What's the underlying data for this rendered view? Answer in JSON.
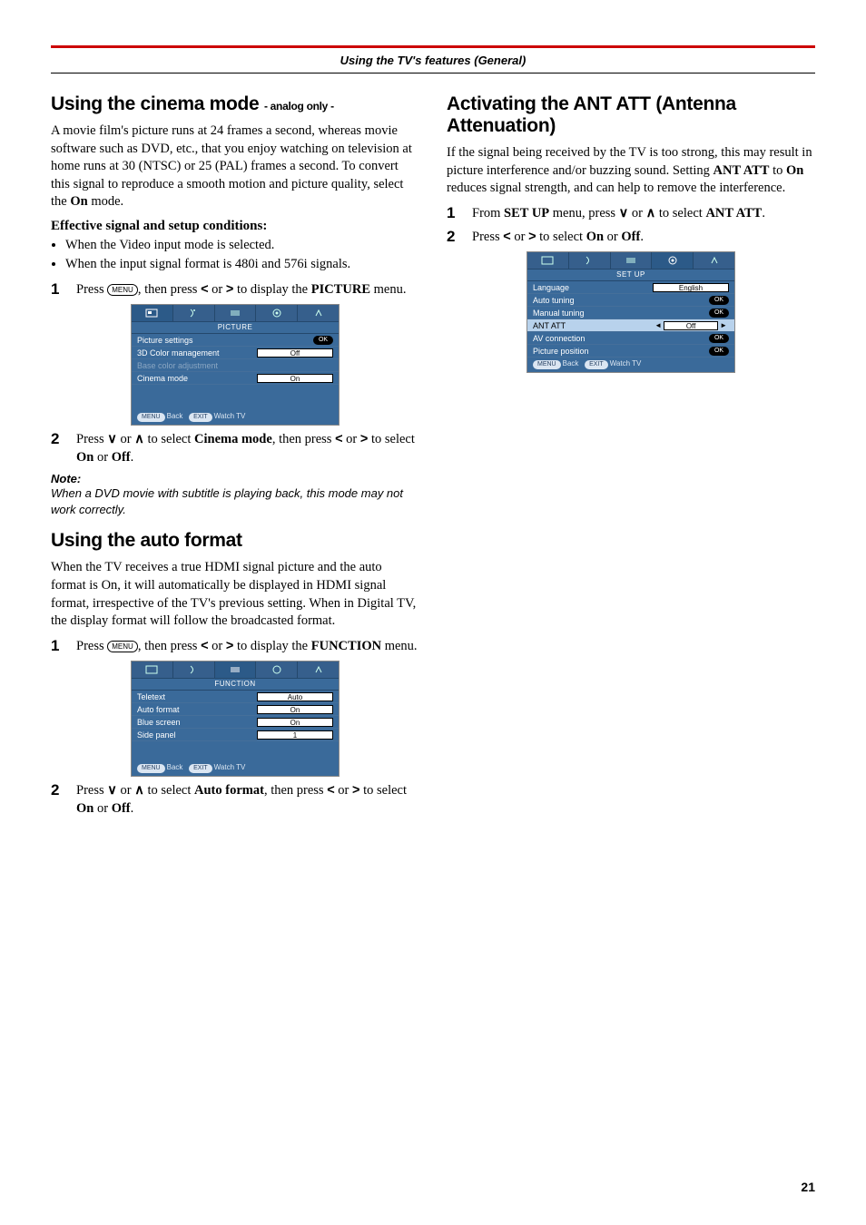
{
  "header": "Using the TV's features (General)",
  "page_number": "21",
  "left": {
    "cinema": {
      "title_main": "Using the cinema mode ",
      "title_sub": "- analog only -",
      "intro": "A movie film's picture runs at 24 frames a second, whereas movie software such as DVD, etc., that you enjoy watching on television at home runs at 30 (NTSC) or 25 (PAL) frames a second. To convert this signal to reproduce a smooth motion and picture quality, select the ",
      "intro_bold": "On",
      "intro_tail": " mode.",
      "eff_head": "Effective signal and setup conditions:",
      "bullets": [
        "When the Video input mode is selected.",
        "When the input signal format is 480i and 576i signals."
      ],
      "step1_a": "Press ",
      "step1_b": ", then press ",
      "step1_c": " or ",
      "step1_d": " to display the ",
      "step1_bold": "PICTURE",
      "step1_e": " menu.",
      "step2_a": "Press ",
      "step2_b": " or ",
      "step2_c": " to select ",
      "step2_bold1": "Cinema mode",
      "step2_d": ", then press ",
      "step2_e": " or ",
      "step2_f": " to select ",
      "step2_bold2": "On",
      "step2_g": " or ",
      "step2_bold3": "Off",
      "step2_h": ".",
      "note_head": "Note:",
      "note_body": "When a DVD movie with subtitle is playing back, this mode may not work correctly.",
      "osd": {
        "title": "PICTURE",
        "rows": [
          {
            "label": "Picture settings",
            "val": "OK",
            "ok": true
          },
          {
            "label": "3D Color management",
            "val": "Off"
          },
          {
            "label": "Base color adjustment",
            "val": "",
            "dim": true,
            "noval": true
          },
          {
            "label": "Cinema mode",
            "val": "On"
          }
        ],
        "foot_menu": "MENU",
        "foot_back": "Back",
        "foot_exit": "EXIT",
        "foot_watch": "Watch TV"
      }
    },
    "autoformat": {
      "title": "Using the auto format",
      "intro": "When the TV receives a true HDMI signal picture and the auto format is On, it will automatically be displayed in HDMI signal format, irrespective of the TV's previous setting. When in Digital TV, the display format will follow the broadcasted format.",
      "step1_a": "Press ",
      "step1_b": ", then press ",
      "step1_c": " or ",
      "step1_d": " to display the ",
      "step1_bold": "FUNCTION",
      "step1_e": " menu.",
      "step2_a": "Press ",
      "step2_b": " or ",
      "step2_c": " to select ",
      "step2_bold1": "Auto format",
      "step2_d": ", then press ",
      "step2_e": " or ",
      "step2_f": " to select ",
      "step2_bold2": "On",
      "step2_g": " or ",
      "step2_bold3": "Off",
      "step2_h": ".",
      "osd": {
        "title": "FUNCTION",
        "rows": [
          {
            "label": "Teletext",
            "val": "Auto"
          },
          {
            "label": "Auto format",
            "val": "On"
          },
          {
            "label": "Blue screen",
            "val": "On"
          },
          {
            "label": "Side panel",
            "val": "1"
          }
        ],
        "foot_menu": "MENU",
        "foot_back": "Back",
        "foot_exit": "EXIT",
        "foot_watch": "Watch TV"
      }
    }
  },
  "right": {
    "ant": {
      "title": "Activating the ANT ATT (Antenna Attenuation)",
      "intro_a": "If the signal being received by the TV is too strong, this may result in picture interference and/or buzzing sound. Setting ",
      "intro_b1": "ANT ATT",
      "intro_b": " to ",
      "intro_b2": "On",
      "intro_c": " reduces signal strength, and can help to remove the interference.",
      "step1_a": "From ",
      "step1_bold1": "SET UP",
      "step1_b": " menu, press ",
      "step1_c": " or ",
      "step1_d": " to select ",
      "step1_bold2": "ANT ATT",
      "step1_e": ".",
      "step2_a": "Press ",
      "step2_b": " or ",
      "step2_c": " to select ",
      "step2_bold1": "On",
      "step2_d": " or ",
      "step2_bold2": "Off",
      "step2_e": ".",
      "osd": {
        "title": "SET UP",
        "rows": [
          {
            "label": "Language",
            "val": "English"
          },
          {
            "label": "Auto tuning",
            "val": "OK",
            "ok": true
          },
          {
            "label": "Manual tuning",
            "val": "OK",
            "ok": true
          },
          {
            "label": "ANT ATT",
            "val": "Off",
            "hi": true,
            "arrows": true
          },
          {
            "label": "AV connection",
            "val": "OK",
            "ok": true
          },
          {
            "label": "Picture position",
            "val": "OK",
            "ok": true
          }
        ],
        "foot_menu": "MENU",
        "foot_back": "Back",
        "foot_exit": "EXIT",
        "foot_watch": "Watch TV"
      }
    }
  },
  "icons": {
    "menu_btn": "MENU"
  }
}
